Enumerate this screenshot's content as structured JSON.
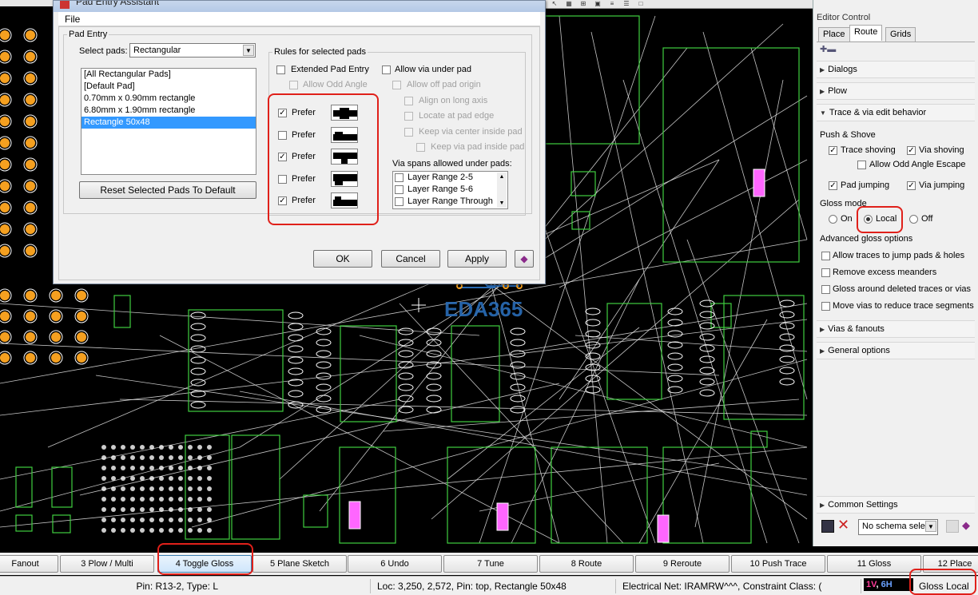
{
  "dialog": {
    "title": "Pad Entry Assistant",
    "menu_file": "File",
    "pad_entry_group": "Pad Entry",
    "select_pads_label": "Select pads:",
    "select_pads_value": "Rectangular",
    "pad_list": [
      "[All Rectangular Pads]",
      "[Default Pad]",
      "0.70mm x 0.90mm rectangle",
      "6.80mm x 1.90mm rectangle",
      "Rectangle 50x48"
    ],
    "reset_button": "Reset Selected Pads To Default",
    "rules_group": "Rules for selected pads",
    "extended_pad_entry": "Extended Pad Entry",
    "allow_odd_angle": "Allow Odd Angle",
    "prefer_label": "Prefer",
    "prefer_states": [
      true,
      false,
      true,
      false,
      true
    ],
    "allow_via_under_pad": "Allow via under pad",
    "allow_off_pad_origin": "Allow off pad origin",
    "align_on_long_axis": "Align on long axis",
    "locate_at_pad_edge": "Locate at pad edge",
    "keep_via_center": "Keep via center inside pad",
    "keep_via_pad": "Keep via pad inside pad",
    "via_spans_label": "Via spans allowed under pads:",
    "via_spans": [
      "Layer Range 2-5",
      "Layer Range 5-6",
      "Layer Range Through"
    ],
    "ok": "OK",
    "cancel": "Cancel",
    "apply": "Apply"
  },
  "editor_control": {
    "title": "Editor Control",
    "tabs": [
      "Place",
      "Route",
      "Grids"
    ],
    "active_tab": "Route",
    "sections": {
      "dialogs": "Dialogs",
      "plow": "Plow",
      "trace_via": "Trace & via edit behavior",
      "vias_fanouts": "Vias & fanouts",
      "general_options": "General options",
      "common_settings": "Common Settings"
    },
    "push_shove": "Push & Shove",
    "trace_shoving": "Trace shoving",
    "via_shoving": "Via shoving",
    "allow_odd_angle_escape": "Allow Odd Angle Escape",
    "pad_jumping": "Pad jumping",
    "via_jumping": "Via jumping",
    "gloss_mode": "Gloss mode",
    "gloss_on": "On",
    "gloss_local": "Local",
    "gloss_off": "Off",
    "advanced_gloss": "Advanced gloss options",
    "adv_options": [
      "Allow traces to jump pads & holes",
      "Remove excess meanders",
      "Gloss around deleted traces or vias",
      "Move vias to reduce trace segments"
    ],
    "schema_select": "No schema selec"
  },
  "fkeys": [
    "Fanout",
    "3 Plow / Multi",
    "4 Toggle Gloss",
    "5 Plane Sketch",
    "6 Undo",
    "7 Tune",
    "8 Route",
    "9 Reroute",
    "10 Push Trace",
    "11 Gloss",
    "12 Place"
  ],
  "status": {
    "pin": "Pin: R13-2, Type: L",
    "loc": "Loc: 3,250, 2,572, Pin: top, Rectangle 50x48",
    "net": "Electrical Net: IRAMRW^^^, Constraint Class: (",
    "layer_a": "1V",
    "layer_b": "6H",
    "gloss": "Gloss Local"
  },
  "watermark": "EDA365",
  "colors": {
    "highlight": "#e0201a",
    "pad": "#f5a020",
    "outline": "#3fcf3f",
    "trace": "#e8e8e8"
  }
}
